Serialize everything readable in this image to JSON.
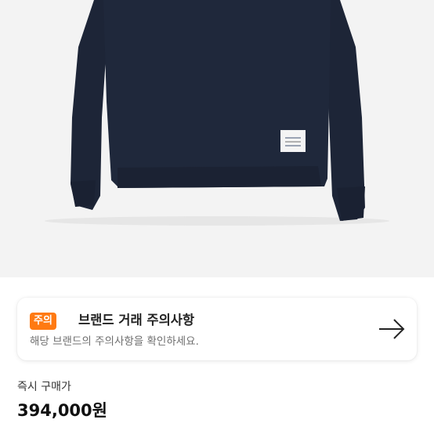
{
  "product": {
    "image_icon": "navy-sweatshirt-photo",
    "image_bg_color": "#f3f3f3",
    "garment_color": "#1e2638"
  },
  "notice": {
    "badge": "주의",
    "badge_color": "#ff7a12",
    "title": "브랜드 거래 주의사항",
    "description": "해당 브랜드의 주의사항을 확인하세요.",
    "arrow_icon": "arrow-right-icon"
  },
  "price": {
    "label": "즉시 구매가",
    "value": "394,000원"
  }
}
